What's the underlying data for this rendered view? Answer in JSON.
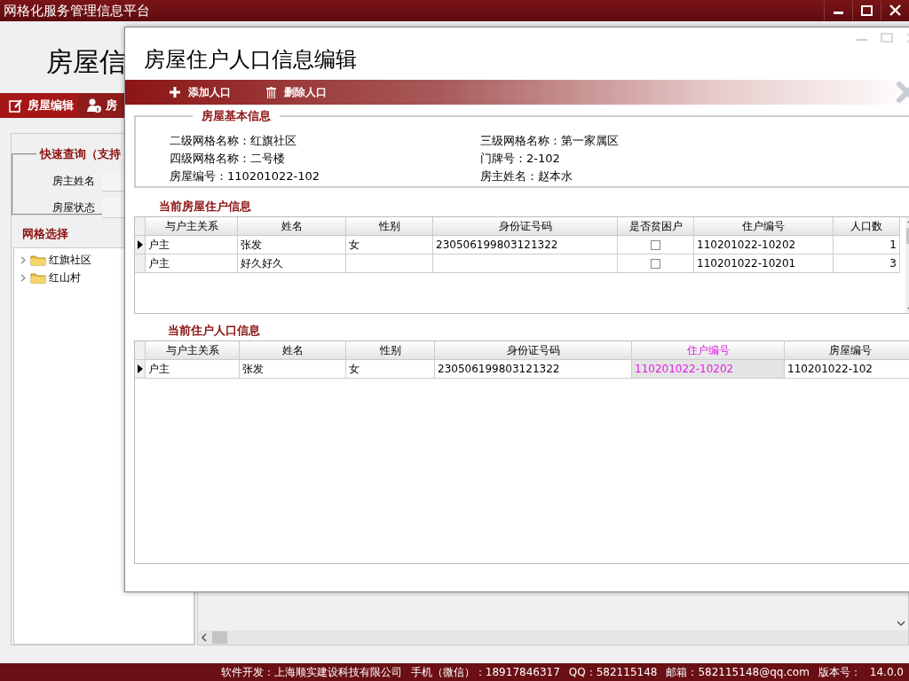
{
  "window": {
    "title": "网格化服务管理信息平台"
  },
  "main": {
    "heading": "房屋信",
    "tabs": [
      {
        "label": "房屋编辑",
        "selected": true
      },
      {
        "label": "房",
        "selected": false
      }
    ],
    "quick_search": {
      "title": "快速查询（支持",
      "fields": [
        {
          "label": "房主姓名"
        },
        {
          "label": "房屋状态"
        }
      ]
    },
    "grid_select": {
      "title": "网格选择",
      "tree": [
        {
          "label": "红旗社区",
          "expanded": false
        },
        {
          "label": "红山村",
          "expanded": false
        }
      ]
    }
  },
  "dialog": {
    "title": "房屋住户人口信息编辑",
    "toolbar": [
      {
        "kind": "add",
        "label": "添加人口"
      },
      {
        "kind": "delete",
        "label": "删除人口"
      }
    ],
    "basic_info": {
      "title": "房屋基本信息",
      "fields": [
        "二级网格名称：红旗社区",
        "三级网格名称：第一家属区",
        "四级网格名称：二号楼",
        "门牌号：2-102",
        "房屋编号：110201022-102",
        "房主姓名：赵本水"
      ]
    },
    "households": {
      "title": "当前房屋住户信息",
      "columns": [
        {
          "label": "与户主关系",
          "kind": "text"
        },
        {
          "label": "姓名",
          "kind": "text"
        },
        {
          "label": "性别",
          "kind": "text"
        },
        {
          "label": "身份证号码",
          "kind": "text"
        },
        {
          "label": "是否贫困户",
          "kind": "check"
        },
        {
          "label": "住户编号",
          "kind": "text"
        },
        {
          "label": "人口数",
          "kind": "number"
        }
      ],
      "rows": [
        {
          "current": true,
          "relation": "户主",
          "name": "张发",
          "gender": "女",
          "id_number": "230506199803121322",
          "poor_household": false,
          "household_no": "110201022-10202",
          "population": "1"
        },
        {
          "current": false,
          "relation": "户主",
          "name": "好久好久",
          "poor_household": false,
          "household_no": "110201022-10201",
          "population": "3"
        }
      ]
    },
    "population": {
      "title": "当前住户人口信息",
      "columns": [
        {
          "label": "与户主关系",
          "kind": "text",
          "selected": false
        },
        {
          "label": "姓名",
          "kind": "text",
          "selected": false
        },
        {
          "label": "性别",
          "kind": "text",
          "selected": false
        },
        {
          "label": "身份证号码",
          "kind": "text",
          "selected": false
        },
        {
          "label": "住户编号",
          "kind": "text",
          "selected": true
        },
        {
          "label": "房屋编号",
          "kind": "text",
          "selected": false
        }
      ],
      "rows": [
        {
          "current": true,
          "relation": "户主",
          "name": "张发",
          "gender": "女",
          "id_number": "230506199803121322",
          "household_no": "110201022-10202",
          "house_no": "110201022-102"
        }
      ]
    }
  },
  "status_bar": [
    "软件开发：上海顺实建设科技有限公司",
    "手机（微信）：18917846317",
    "QQ：582115148",
    "邮箱：582115148@qq.com",
    "版本号：",
    "14.0.0"
  ]
}
